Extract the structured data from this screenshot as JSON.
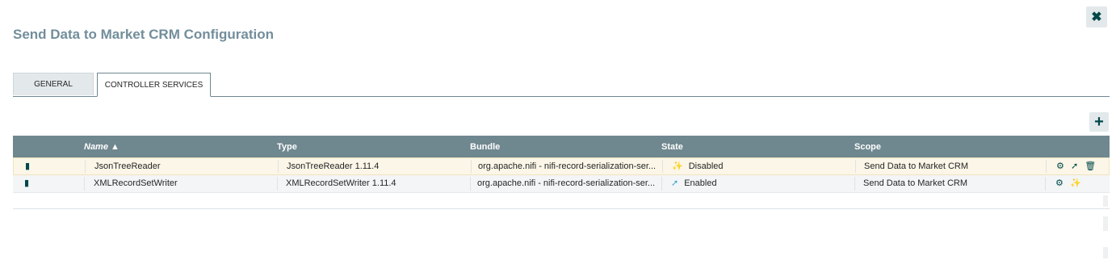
{
  "dialog": {
    "title": "Send Data to Market CRM Configuration",
    "close_icon": "✖"
  },
  "tabs": [
    {
      "label": "GENERAL",
      "active": false
    },
    {
      "label": "CONTROLLER SERVICES",
      "active": true
    }
  ],
  "toolbar": {
    "add_icon": "+"
  },
  "table": {
    "columns": [
      "Name ▲",
      "Type",
      "Bundle",
      "State",
      "Scope"
    ],
    "rows": [
      {
        "name": "JsonTreeReader",
        "type": "JsonTreeReader 1.11.4",
        "bundle": "org.apache.nifi - nifi-record-serialization-ser...",
        "state": "Disabled",
        "scope": "Send Data to Market CRM"
      },
      {
        "name": "XMLRecordSetWriter",
        "type": "XMLRecordSetWriter 1.11.4",
        "bundle": "org.apache.nifi - nifi-record-serialization-ser...",
        "state": "Enabled",
        "scope": "Send Data to Market CRM"
      }
    ]
  },
  "colors": {
    "title": "#728e9b",
    "header_bg": "#6f878f",
    "accent": "#004849",
    "enabled": "#44a3cf"
  }
}
